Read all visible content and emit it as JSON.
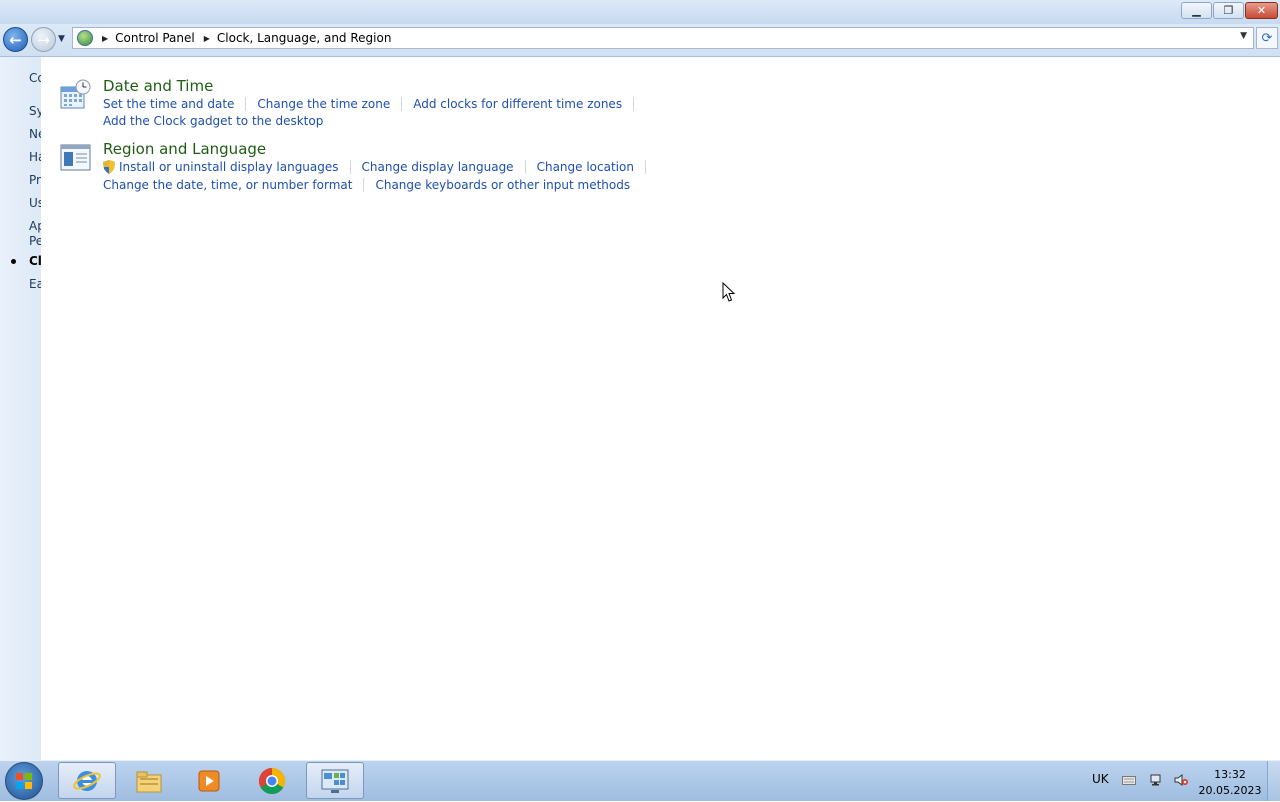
{
  "window": {
    "minimize_glyph": "▁",
    "maximize_glyph": "❐",
    "close_glyph": "✕"
  },
  "nav": {
    "back_glyph": "←",
    "forward_glyph": "→",
    "history_glyph": "▼",
    "breadcrumb": [
      "Control Panel",
      "Clock, Language, and Region"
    ],
    "address_dropdown_glyph": "▼",
    "refresh_glyph": "⟳"
  },
  "sidebar": {
    "items": [
      {
        "label": "Co"
      },
      {
        "label": "Sy"
      },
      {
        "label": "Ne"
      },
      {
        "label": "Ha"
      },
      {
        "label": "Pr"
      },
      {
        "label": "Us"
      },
      {
        "label": "Ap"
      },
      {
        "label": "Pe"
      },
      {
        "label": "Cl",
        "active": true
      },
      {
        "label": "Ea"
      }
    ]
  },
  "categories": [
    {
      "title": "Date and Time",
      "icon": "clock-calendar-icon",
      "links_row1": [
        "Set the time and date",
        "Change the time zone",
        "Add clocks for different time zones"
      ],
      "links_row2": [
        "Add the Clock gadget to the desktop"
      ]
    },
    {
      "title": "Region and Language",
      "icon": "globe-window-icon",
      "links_row1": [
        "Install or uninstall display languages",
        "Change display language",
        "Change location"
      ],
      "links_row2": [
        "Change the date, time, or number format",
        "Change keyboards or other input methods"
      ]
    }
  ],
  "taskbar": {
    "apps": [
      "internet-explorer-icon",
      "file-explorer-icon",
      "media-player-icon",
      "chrome-icon",
      "control-panel-icon"
    ],
    "tray": {
      "language": "UK",
      "time": "13:32",
      "date": "20.05.2023"
    }
  },
  "colors": {
    "link": "#1e4fb0",
    "category_title": "#1e5e13",
    "taskbar": "#a9c4e6"
  }
}
